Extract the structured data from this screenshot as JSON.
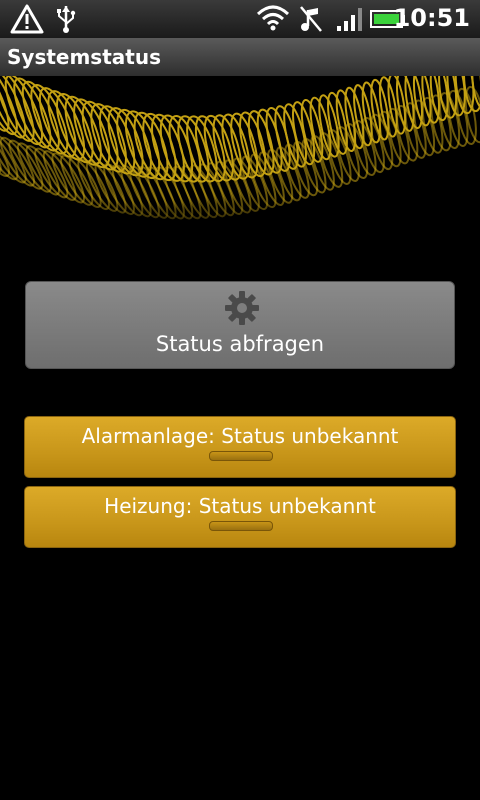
{
  "status_bar": {
    "time": "10:51",
    "icons": [
      "warning-icon",
      "usb-icon",
      "wifi-icon",
      "music-off-icon",
      "signal-icon",
      "battery-icon"
    ]
  },
  "header": {
    "title": "Systemstatus"
  },
  "main": {
    "query_button": {
      "label": "Status abfragen",
      "icon": "gear-icon"
    },
    "status_items": [
      {
        "label": "Alarmanlage: Status unbekannt"
      },
      {
        "label": "Heizung: Status unbekannt"
      }
    ]
  },
  "colors": {
    "accent": "#d4a020",
    "button_gray": "#7c7c7c",
    "background": "#000000"
  }
}
